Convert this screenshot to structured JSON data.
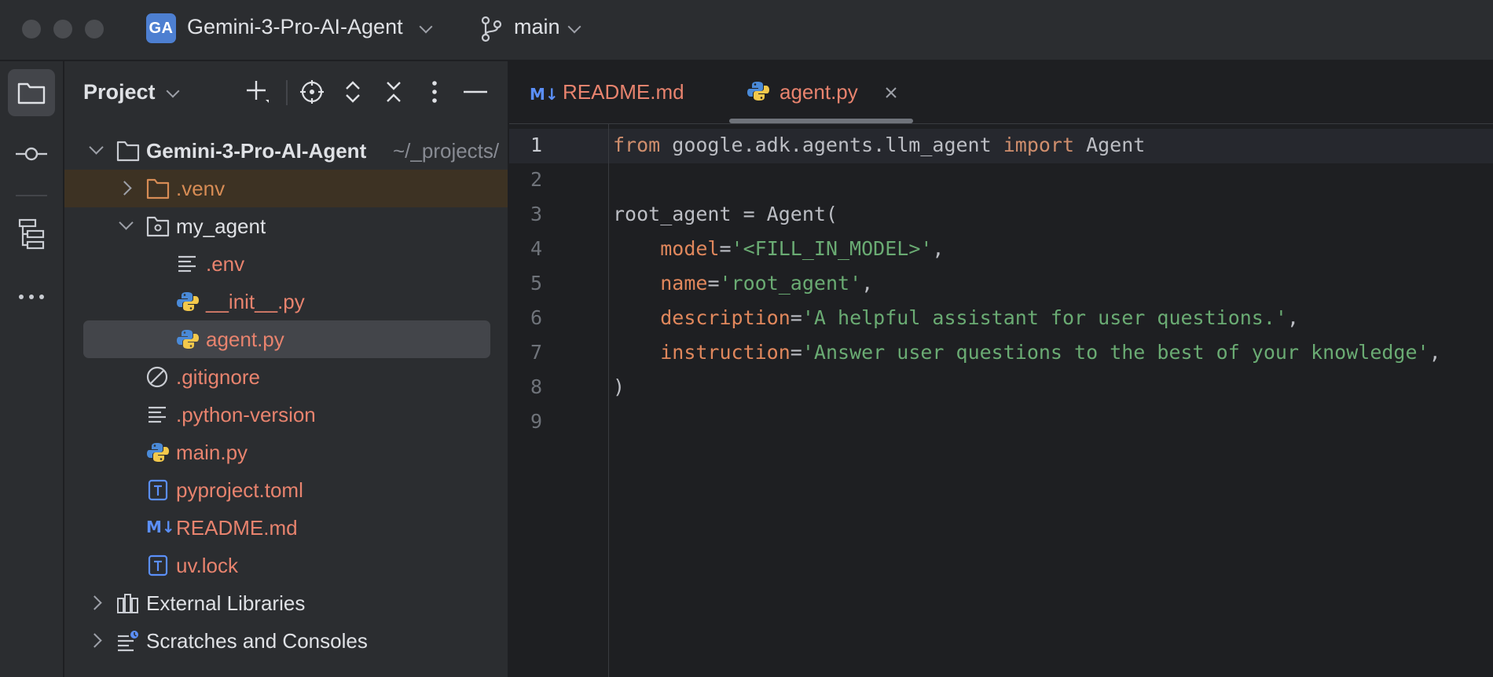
{
  "titlebar": {
    "project_badge": "GA",
    "project_name": "Gemini-3-Pro-AI-Agent",
    "branch": "main"
  },
  "activity_bar": {
    "items": [
      "folder-icon",
      "commit-icon",
      "structure-icon",
      "more-icon"
    ]
  },
  "project_panel": {
    "title": "Project",
    "tree": [
      {
        "label": "Gemini-3-Pro-AI-Agent",
        "path": "~/_projects/",
        "type": "root",
        "expanded": true
      },
      {
        "label": ".venv",
        "type": "folder",
        "expanded": false
      },
      {
        "label": "my_agent",
        "type": "package",
        "expanded": true
      },
      {
        "label": ".env",
        "type": "text"
      },
      {
        "label": "__init__.py",
        "type": "python"
      },
      {
        "label": "agent.py",
        "type": "python",
        "selected": true
      },
      {
        "label": ".gitignore",
        "type": "ignore"
      },
      {
        "label": ".python-version",
        "type": "text"
      },
      {
        "label": "main.py",
        "type": "python"
      },
      {
        "label": "pyproject.toml",
        "type": "toml"
      },
      {
        "label": "README.md",
        "type": "markdown"
      },
      {
        "label": "uv.lock",
        "type": "toml"
      },
      {
        "label": "External Libraries",
        "type": "libraries",
        "expanded": false
      },
      {
        "label": "Scratches and Consoles",
        "type": "scratches",
        "expanded": false
      }
    ]
  },
  "editor": {
    "tabs": [
      {
        "label": "README.md",
        "active": false
      },
      {
        "label": "agent.py",
        "active": true
      }
    ],
    "line_numbers": [
      "1",
      "2",
      "3",
      "4",
      "5",
      "6",
      "7",
      "8",
      "9"
    ],
    "current_line": 1,
    "code": {
      "l1_from": "from",
      "l1_module": " google.adk.agents.llm_agent ",
      "l1_import": "import",
      "l1_name": " Agent",
      "l3": "root_agent = Agent(",
      "l4_param": "model",
      "l4_value": "'<FILL_IN_MODEL>'",
      "l5_param": "name",
      "l5_value": "'root_agent'",
      "l6_param": "description",
      "l6_value": "'A helpful assistant for user questions.'",
      "l7_param": "instruction",
      "l7_value": "'Answer user questions to the best of your knowledge'",
      "l8": ")"
    }
  },
  "colors": {
    "keyword": "#cf8e6d",
    "parameter": "#e0875c",
    "string": "#6aab73",
    "file_modified": "#e8836e",
    "accent": "#4d7fd1"
  }
}
